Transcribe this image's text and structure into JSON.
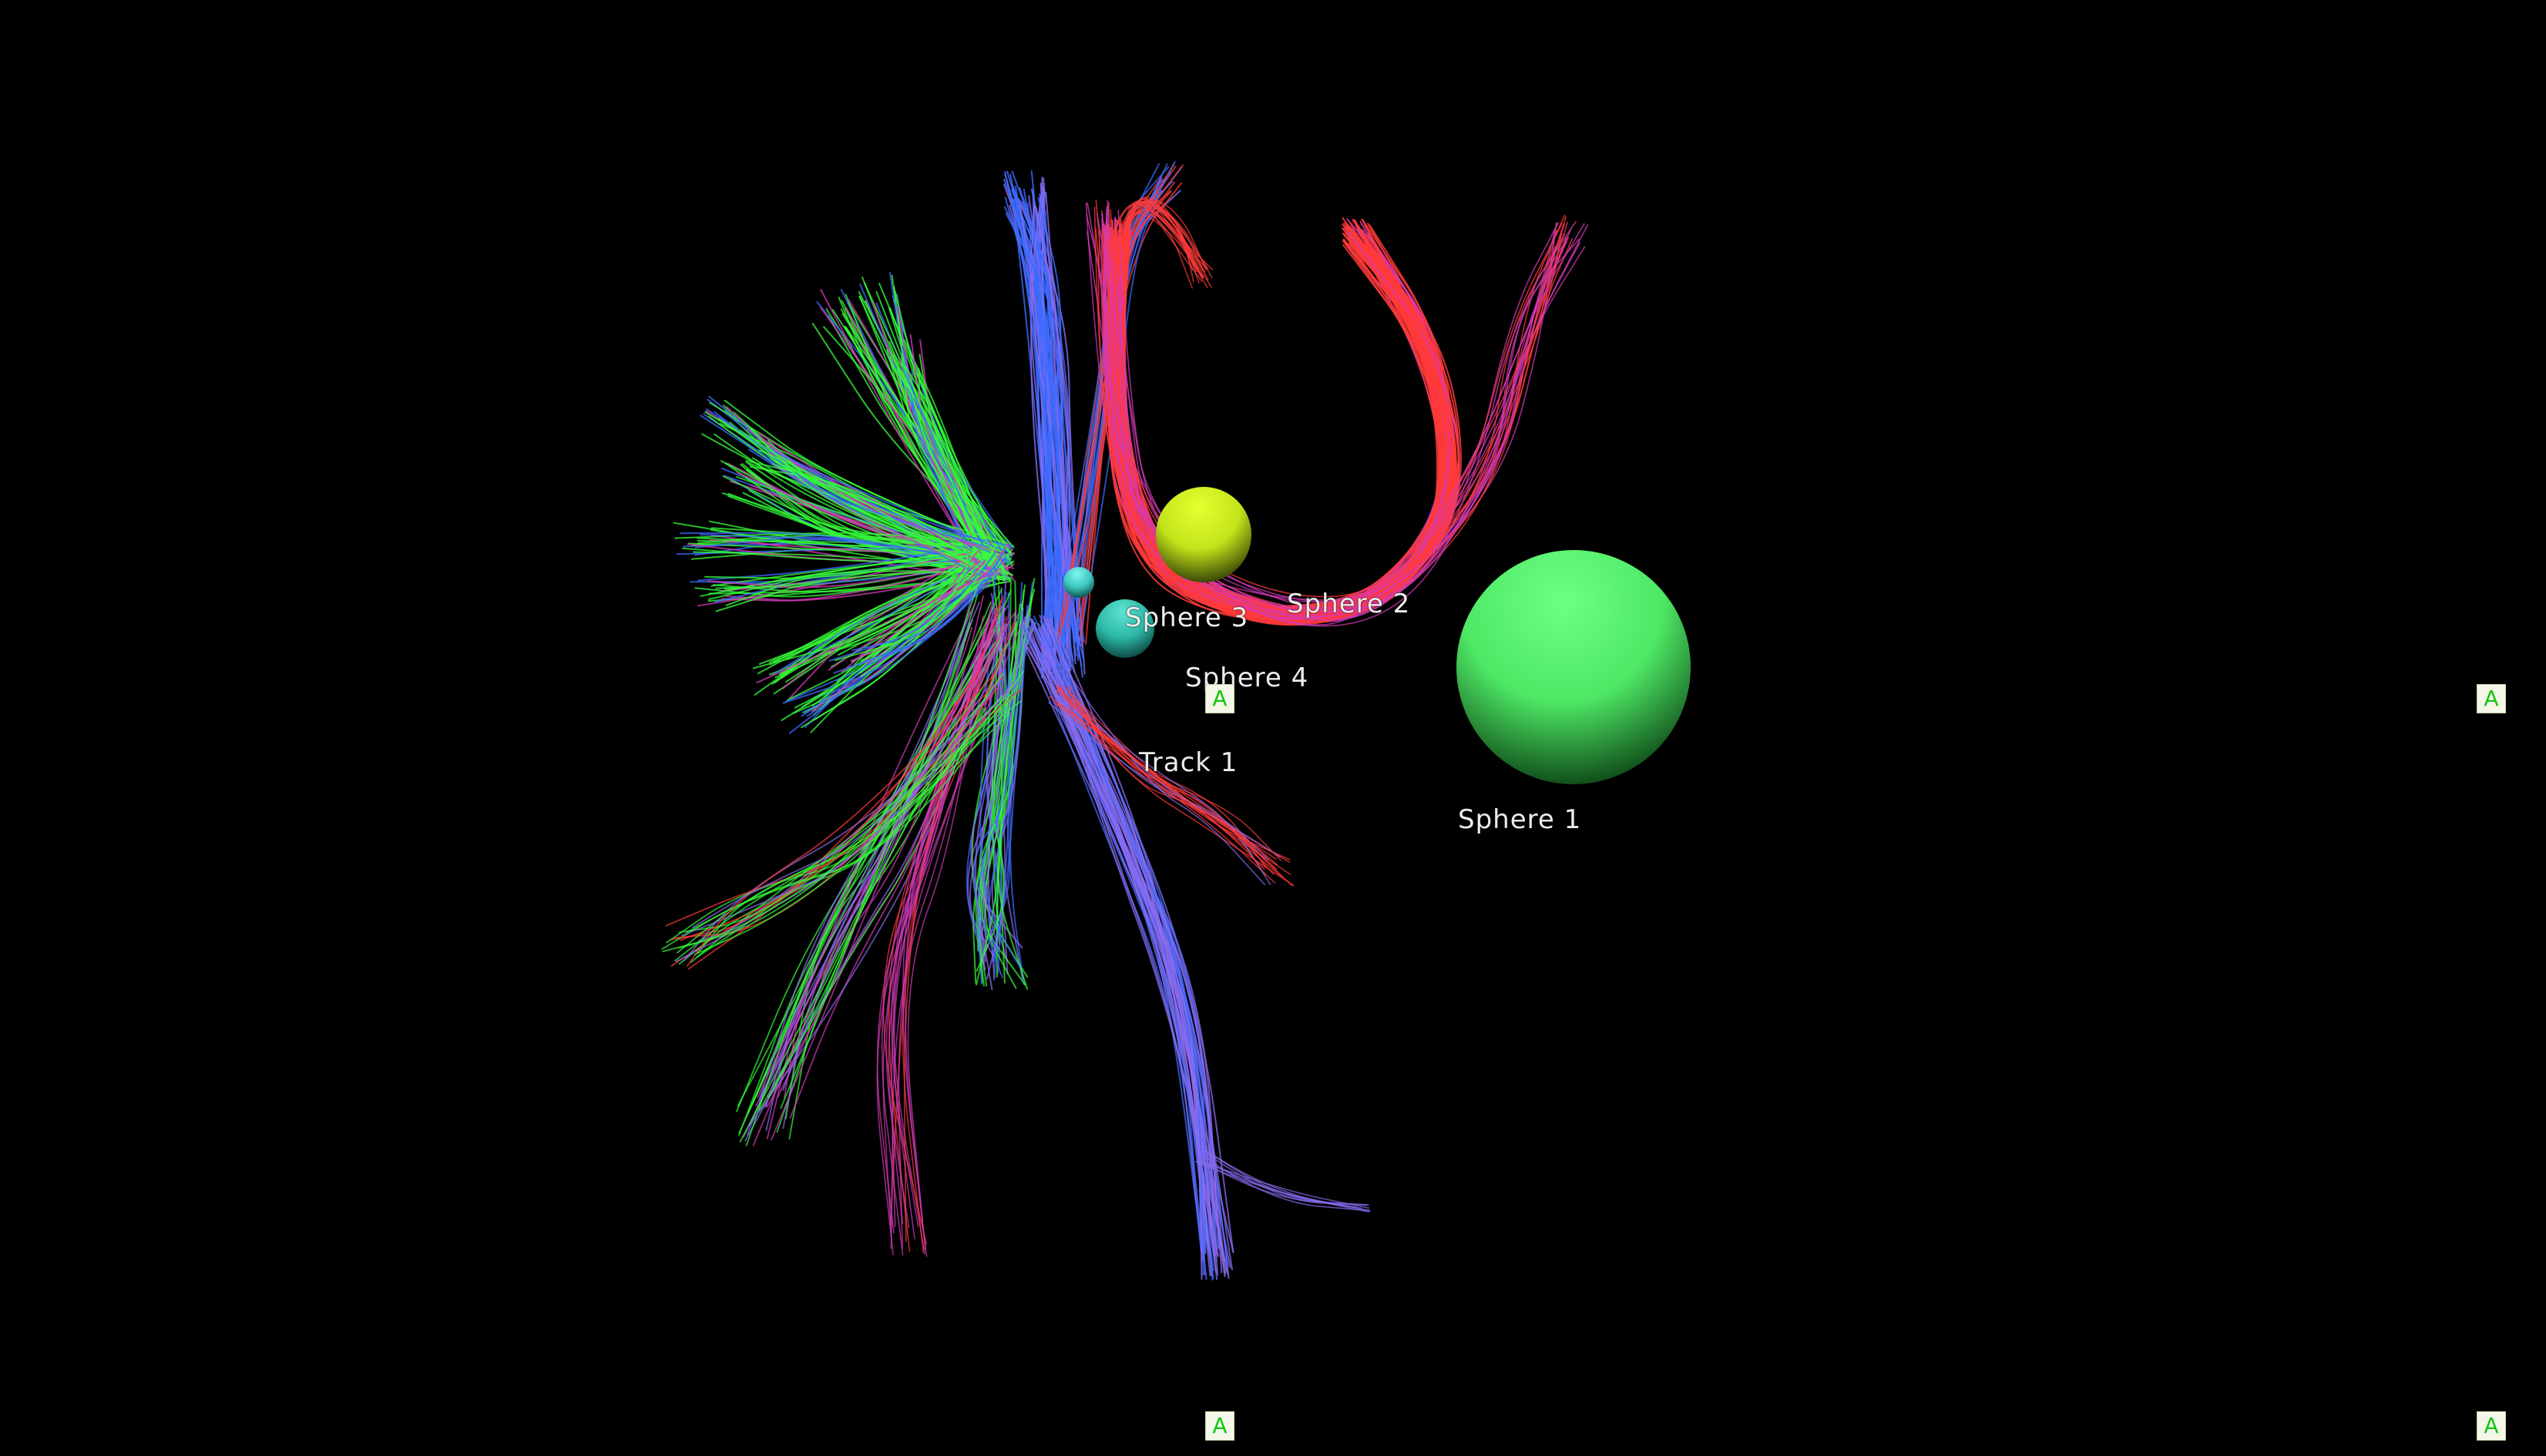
{
  "scene": {
    "background_color": "#000000",
    "labels": {
      "sphere_1": "Sphere 1",
      "sphere_2": "Sphere 2",
      "sphere_3": "Sphere 3",
      "sphere_4": "Sphere 4",
      "track_1": "Track 1"
    },
    "colors": {
      "sphere_1": "#4ee865",
      "sphere_2": "#c3e41b",
      "sphere_3": "#2bb7a7",
      "sphere_4": "#3cc8c0",
      "fibers_red": "#ff3a3a",
      "fibers_green": "#35ff3a",
      "fibers_blue": "#3c6bff",
      "fibers_magenta": "#d43ab8",
      "fibers_purple": "#8a6cf2",
      "label_text": "#ececec"
    }
  },
  "markers": {
    "glyph": "A",
    "icon": "axis-annotation-icon",
    "color": "#11c611"
  }
}
